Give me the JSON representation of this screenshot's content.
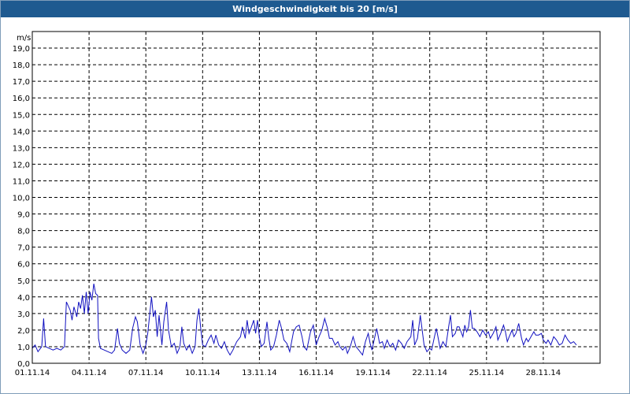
{
  "window": {
    "title": "Windgeschwindigkeit bis 20 [m/s]"
  },
  "chart_data": {
    "type": "line",
    "title": "Windgeschwindigkeit bis 20 [m/s]",
    "ylabel": "m/s",
    "xlabel": "",
    "ylim": [
      0,
      20
    ],
    "xlim": [
      "01.11.14",
      "30.11.14 23:00"
    ],
    "grid": true,
    "grid_style": "dashed",
    "line_color": "#1010c0",
    "y_ticks": [
      "0,0",
      "1,0",
      "2,0",
      "3,0",
      "4,0",
      "5,0",
      "6,0",
      "7,0",
      "8,0",
      "9,0",
      "10,0",
      "11,0",
      "12,0",
      "13,0",
      "14,0",
      "15,0",
      "16,0",
      "17,0",
      "18,0",
      "19,0"
    ],
    "x_ticks": [
      "01.11.14",
      "04.11.14",
      "07.11.14",
      "10.11.14",
      "13.11.14",
      "16.11.14",
      "19.11.14",
      "22.11.14",
      "25.11.14",
      "28.11.14"
    ],
    "series": [
      {
        "values": [
          [
            0,
            0.9
          ],
          [
            0.15,
            1.1
          ],
          [
            0.3,
            0.7
          ],
          [
            0.5,
            1.0
          ],
          [
            0.6,
            2.7
          ],
          [
            0.7,
            1.0
          ],
          [
            0.9,
            0.9
          ],
          [
            1.1,
            0.8
          ],
          [
            1.3,
            0.9
          ],
          [
            1.5,
            0.8
          ],
          [
            1.7,
            1.0
          ],
          [
            1.8,
            3.7
          ],
          [
            2.0,
            3.2
          ],
          [
            2.1,
            2.6
          ],
          [
            2.2,
            3.4
          ],
          [
            2.35,
            2.8
          ],
          [
            2.45,
            3.7
          ],
          [
            2.55,
            3.3
          ],
          [
            2.65,
            4.1
          ],
          [
            2.75,
            3.0
          ],
          [
            2.85,
            4.3
          ],
          [
            2.95,
            3.0
          ],
          [
            3.05,
            4.3
          ],
          [
            3.15,
            3.8
          ],
          [
            3.25,
            4.8
          ],
          [
            3.35,
            4.2
          ],
          [
            3.45,
            4.1
          ],
          [
            3.5,
            1.5
          ],
          [
            3.6,
            0.9
          ],
          [
            3.8,
            0.8
          ],
          [
            4.0,
            0.7
          ],
          [
            4.2,
            0.6
          ],
          [
            4.35,
            0.8
          ],
          [
            4.5,
            2.1
          ],
          [
            4.6,
            1.2
          ],
          [
            4.75,
            0.8
          ],
          [
            4.95,
            0.6
          ],
          [
            5.15,
            0.8
          ],
          [
            5.3,
            2.1
          ],
          [
            5.45,
            2.8
          ],
          [
            5.55,
            2.5
          ],
          [
            5.7,
            1.1
          ],
          [
            5.85,
            0.6
          ],
          [
            6.0,
            1.1
          ],
          [
            6.1,
            1.8
          ],
          [
            6.3,
            4.0
          ],
          [
            6.4,
            2.8
          ],
          [
            6.5,
            3.2
          ],
          [
            6.6,
            1.6
          ],
          [
            6.7,
            2.9
          ],
          [
            6.85,
            1.1
          ],
          [
            6.95,
            2.5
          ],
          [
            7.1,
            3.7
          ],
          [
            7.2,
            2.0
          ],
          [
            7.35,
            1.0
          ],
          [
            7.5,
            1.2
          ],
          [
            7.65,
            0.6
          ],
          [
            7.8,
            1.0
          ],
          [
            7.9,
            2.2
          ],
          [
            8.0,
            1.2
          ],
          [
            8.15,
            0.8
          ],
          [
            8.3,
            1.1
          ],
          [
            8.45,
            0.6
          ],
          [
            8.6,
            1.0
          ],
          [
            8.7,
            2.6
          ],
          [
            8.8,
            3.3
          ],
          [
            8.9,
            2.1
          ],
          [
            9.0,
            1.1
          ],
          [
            9.15,
            1.0
          ],
          [
            9.3,
            1.4
          ],
          [
            9.45,
            1.7
          ],
          [
            9.6,
            1.2
          ],
          [
            9.7,
            1.7
          ],
          [
            9.85,
            1.1
          ],
          [
            10.0,
            0.9
          ],
          [
            10.15,
            1.3
          ],
          [
            10.3,
            0.8
          ],
          [
            10.45,
            0.5
          ],
          [
            10.6,
            0.8
          ],
          [
            10.8,
            1.3
          ],
          [
            11.0,
            1.6
          ],
          [
            11.1,
            2.2
          ],
          [
            11.25,
            1.5
          ],
          [
            11.35,
            2.6
          ],
          [
            11.45,
            1.8
          ],
          [
            11.55,
            2.1
          ],
          [
            11.7,
            2.6
          ],
          [
            11.8,
            1.8
          ],
          [
            11.9,
            2.6
          ],
          [
            12.0,
            1.6
          ],
          [
            12.1,
            1.0
          ],
          [
            12.25,
            1.2
          ],
          [
            12.4,
            2.5
          ],
          [
            12.5,
            1.5
          ],
          [
            12.6,
            0.8
          ],
          [
            12.75,
            1.0
          ],
          [
            12.9,
            1.7
          ],
          [
            13.05,
            2.6
          ],
          [
            13.15,
            2.2
          ],
          [
            13.3,
            1.4
          ],
          [
            13.45,
            1.2
          ],
          [
            13.6,
            0.7
          ],
          [
            13.8,
            1.9
          ],
          [
            13.95,
            2.2
          ],
          [
            14.1,
            2.3
          ],
          [
            14.25,
            1.6
          ],
          [
            14.35,
            1.0
          ],
          [
            14.5,
            0.8
          ],
          [
            14.7,
            1.9
          ],
          [
            14.85,
            2.3
          ],
          [
            15.0,
            1.1
          ],
          [
            15.15,
            1.6
          ],
          [
            15.3,
            2.0
          ],
          [
            15.45,
            2.7
          ],
          [
            15.6,
            2.1
          ],
          [
            15.7,
            1.5
          ],
          [
            15.85,
            1.5
          ],
          [
            16.0,
            1.1
          ],
          [
            16.15,
            1.3
          ],
          [
            16.25,
            1.0
          ],
          [
            16.4,
            0.8
          ],
          [
            16.55,
            1.0
          ],
          [
            16.65,
            0.6
          ],
          [
            16.8,
            1.0
          ],
          [
            16.95,
            1.6
          ],
          [
            17.1,
            1.0
          ],
          [
            17.25,
            0.8
          ],
          [
            17.45,
            0.5
          ],
          [
            17.6,
            1.3
          ],
          [
            17.75,
            1.8
          ],
          [
            17.85,
            1.2
          ],
          [
            17.95,
            0.8
          ],
          [
            18.1,
            1.6
          ],
          [
            18.2,
            2.1
          ],
          [
            18.35,
            1.2
          ],
          [
            18.5,
            1.3
          ],
          [
            18.6,
            0.9
          ],
          [
            18.75,
            1.4
          ],
          [
            18.9,
            1.0
          ],
          [
            19.05,
            1.2
          ],
          [
            19.2,
            0.8
          ],
          [
            19.35,
            1.4
          ],
          [
            19.5,
            1.2
          ],
          [
            19.65,
            0.9
          ],
          [
            19.8,
            1.3
          ],
          [
            20.0,
            1.6
          ],
          [
            20.1,
            2.6
          ],
          [
            20.2,
            1.1
          ],
          [
            20.35,
            1.5
          ],
          [
            20.5,
            2.9
          ],
          [
            20.6,
            2.0
          ],
          [
            20.7,
            1.1
          ],
          [
            20.85,
            0.7
          ],
          [
            21.0,
            0.9
          ],
          [
            21.1,
            0.8
          ],
          [
            21.25,
            1.6
          ],
          [
            21.35,
            2.1
          ],
          [
            21.45,
            1.5
          ],
          [
            21.55,
            0.9
          ],
          [
            21.7,
            1.3
          ],
          [
            21.85,
            1.0
          ],
          [
            22.0,
            2.2
          ],
          [
            22.1,
            2.9
          ],
          [
            22.2,
            1.6
          ],
          [
            22.35,
            1.8
          ],
          [
            22.45,
            2.2
          ],
          [
            22.55,
            2.2
          ],
          [
            22.65,
            1.9
          ],
          [
            22.75,
            1.6
          ],
          [
            22.85,
            2.3
          ],
          [
            22.95,
            1.9
          ],
          [
            23.05,
            2.2
          ],
          [
            23.15,
            3.2
          ],
          [
            23.25,
            2.1
          ],
          [
            23.35,
            2.1
          ],
          [
            23.5,
            1.9
          ],
          [
            23.65,
            1.6
          ],
          [
            23.8,
            2.0
          ],
          [
            23.95,
            1.7
          ],
          [
            24.1,
            1.9
          ],
          [
            24.2,
            1.5
          ],
          [
            24.35,
            1.8
          ],
          [
            24.5,
            2.2
          ],
          [
            24.6,
            1.4
          ],
          [
            24.75,
            1.8
          ],
          [
            24.9,
            2.3
          ],
          [
            25.0,
            1.9
          ],
          [
            25.1,
            1.3
          ],
          [
            25.2,
            1.6
          ],
          [
            25.35,
            2.0
          ],
          [
            25.45,
            1.6
          ],
          [
            25.55,
            1.8
          ],
          [
            25.7,
            2.4
          ],
          [
            25.85,
            1.5
          ],
          [
            25.95,
            1.1
          ],
          [
            26.1,
            1.5
          ],
          [
            26.2,
            1.3
          ],
          [
            26.35,
            1.6
          ],
          [
            26.5,
            1.9
          ],
          [
            26.6,
            1.7
          ],
          [
            26.75,
            1.7
          ],
          [
            26.9,
            1.8
          ],
          [
            27.0,
            1.4
          ],
          [
            27.15,
            1.2
          ],
          [
            27.25,
            1.4
          ],
          [
            27.4,
            1.1
          ],
          [
            27.55,
            1.6
          ],
          [
            27.7,
            1.4
          ],
          [
            27.85,
            1.1
          ],
          [
            28.0,
            1.2
          ],
          [
            28.15,
            1.7
          ],
          [
            28.3,
            1.4
          ],
          [
            28.45,
            1.2
          ],
          [
            28.6,
            1.3
          ],
          [
            28.75,
            1.1
          ]
        ]
      }
    ]
  }
}
